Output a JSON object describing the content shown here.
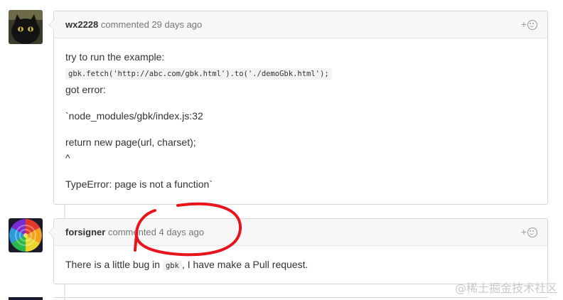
{
  "comments": [
    {
      "author": "wx2228",
      "meta": "commented 29 days ago",
      "reaction_label": "+",
      "body": {
        "line1": "try to run the example:",
        "code1": "gbk.fetch('http://abc.com/gbk.html').to('./demoGbk.html');",
        "line2": "got error:",
        "line3": "`node_modules/gbk/index.js:32",
        "line4": "return new page(url, charset);",
        "line5": "^",
        "line6": "TypeError: page is not a function`"
      }
    },
    {
      "author": "forsigner",
      "meta": "commented 4 days ago",
      "reaction_label": "+",
      "body": {
        "text_before": "There is a little bug in ",
        "code": "gbk",
        "text_after": ", I have make a Pull request."
      }
    }
  ],
  "watermark": "@稀土掘金技术社区",
  "colors": {
    "annotation_red": "#e8141b",
    "border": "#d8d8d8",
    "header_bg": "#f7f7f7"
  },
  "icons": [
    "cat-avatar-image",
    "rose-avatar-image",
    "smiley-reaction-icon"
  ]
}
